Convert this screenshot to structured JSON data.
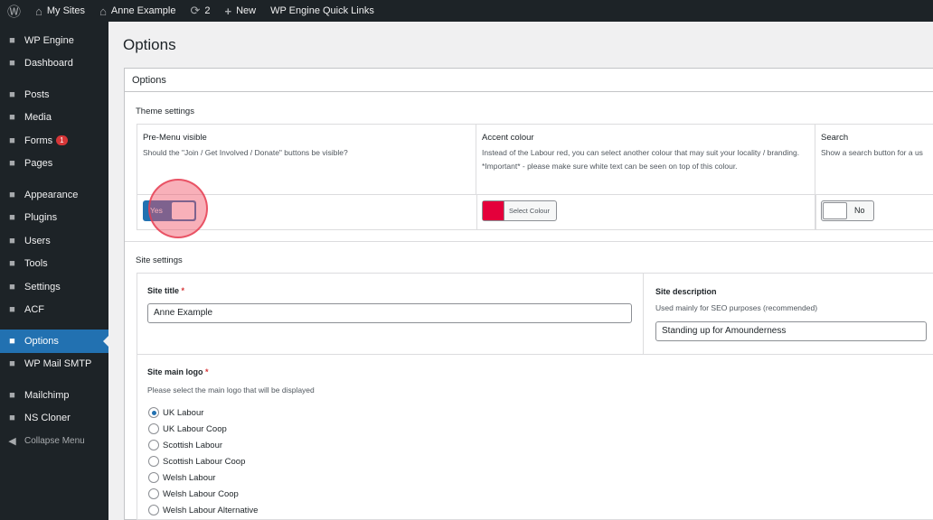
{
  "adminbar": {
    "my_sites": "My Sites",
    "site": "Anne Example",
    "updates": "2",
    "new": "New",
    "quick_links": "WP Engine Quick Links"
  },
  "sidebar": {
    "items": [
      {
        "label": "WP Engine",
        "icon": "grid-icon"
      },
      {
        "label": "Dashboard",
        "icon": "gauge-icon"
      },
      {
        "label": "Posts",
        "icon": "pin-icon"
      },
      {
        "label": "Media",
        "icon": "media-icon"
      },
      {
        "label": "Forms",
        "icon": "forms-icon",
        "badge": "1"
      },
      {
        "label": "Pages",
        "icon": "page-icon"
      },
      {
        "label": "Appearance",
        "icon": "brush-icon"
      },
      {
        "label": "Plugins",
        "icon": "plug-icon"
      },
      {
        "label": "Users",
        "icon": "user-icon"
      },
      {
        "label": "Tools",
        "icon": "wrench-icon"
      },
      {
        "label": "Settings",
        "icon": "settings-icon"
      },
      {
        "label": "ACF",
        "icon": "acf-icon"
      },
      {
        "label": "Options",
        "icon": "gear-icon"
      },
      {
        "label": "WP Mail SMTP",
        "icon": "mail-icon"
      },
      {
        "label": "Mailchimp",
        "icon": "mailchimp-icon"
      },
      {
        "label": "NS Cloner",
        "icon": "cloner-icon"
      }
    ],
    "collapse": "Collapse Menu"
  },
  "page": {
    "title": "Options",
    "panel_title": "Options"
  },
  "theme": {
    "label": "Theme settings",
    "premenu": {
      "label": "Pre-Menu visible",
      "desc": "Should the \"Join / Get Involved / Donate\" buttons be visible?",
      "value": "Yes"
    },
    "accent": {
      "label": "Accent colour",
      "desc": "Instead of the Labour red, you can select another colour that may suit your locality / branding. *Important* - please make sure white text can be seen on top of this colour.",
      "button": "Select Colour",
      "color": "#e4003b"
    },
    "search": {
      "label": "Search",
      "desc": "Show a search button for a us",
      "value": "No"
    }
  },
  "site": {
    "label": "Site settings",
    "title": {
      "label": "Site title",
      "required": "*",
      "value": "Anne Example"
    },
    "description": {
      "label": "Site description",
      "desc": "Used mainly for SEO purposes (recommended)",
      "value": "Standing up for Amounderness"
    },
    "logo": {
      "label": "Site main logo",
      "required": "*",
      "desc": "Please select the main logo that will be displayed",
      "options": [
        "UK Labour",
        "UK Labour Coop",
        "Scottish Labour",
        "Scottish Labour Coop",
        "Welsh Labour",
        "Welsh Labour Coop",
        "Welsh Labour Alternative"
      ],
      "selected": 0
    }
  }
}
